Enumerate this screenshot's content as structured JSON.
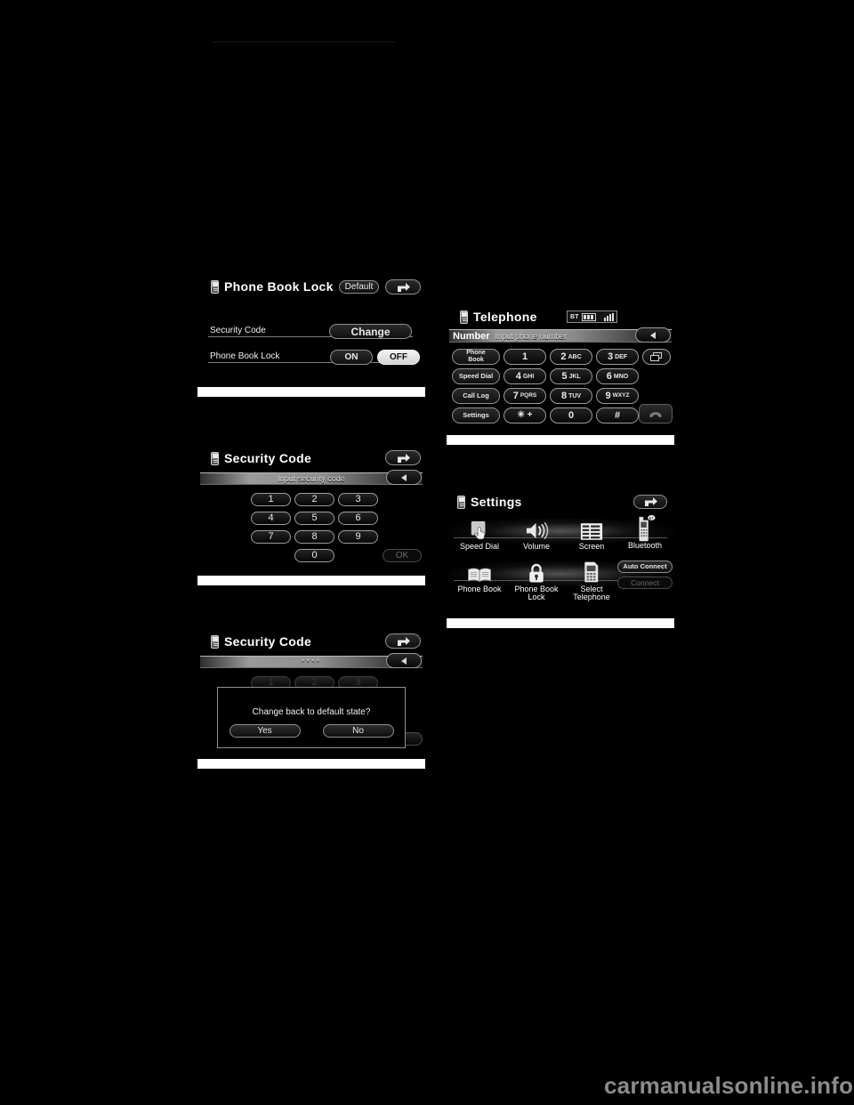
{
  "page": {
    "background": "#000000",
    "watermark": "carmanualsonline.info"
  },
  "screens": {
    "phone_book_lock": {
      "title": "Phone Book Lock",
      "title_icon": "phone-icon",
      "buttons": {
        "default": "Default",
        "back": "back-arrow-icon"
      },
      "rows": [
        {
          "label": "Security Code",
          "action": "Change",
          "action_state": "normal"
        },
        {
          "label": "Phone Book Lock",
          "options": [
            {
              "label": "ON",
              "selected": false
            },
            {
              "label": "OFF",
              "selected": true
            }
          ]
        }
      ]
    },
    "security_code_input": {
      "title": "Security Code",
      "title_icon": "phone-icon",
      "buttons": {
        "back": "back-arrow-icon",
        "delete": "delete-arrow-icon",
        "ok": "OK",
        "ok_state": "disabled"
      },
      "input": {
        "value": "",
        "placeholder": "Input security code"
      },
      "keypad": [
        "1",
        "2",
        "3",
        "4",
        "5",
        "6",
        "7",
        "8",
        "9",
        "0"
      ]
    },
    "security_code_dialog": {
      "title": "Security Code",
      "title_icon": "phone-icon",
      "buttons": {
        "back": "back-arrow-icon",
        "delete": "delete-arrow-icon"
      },
      "input": {
        "value": "****",
        "placeholder": ""
      },
      "keypad_behind": [
        "1",
        "2",
        "3"
      ],
      "dialog": {
        "message": "Change back to default state?",
        "yes": "Yes",
        "no": "No"
      }
    },
    "telephone": {
      "title": "Telephone",
      "title_icon": "phone-icon",
      "status": {
        "bt_label": "BT",
        "battery_bars": 3,
        "signal_bars": 4
      },
      "number_field": {
        "label": "Number",
        "placeholder": "Input phone number",
        "value": ""
      },
      "side_buttons": [
        "Phone\nBook",
        "Speed Dial",
        "Call Log",
        "Settings"
      ],
      "side_buttons_flat": [
        "Phone Book",
        "Speed Dial",
        "Call Log",
        "Settings"
      ],
      "keys": [
        {
          "digit": "1",
          "letters": ""
        },
        {
          "digit": "2",
          "letters": "ABC"
        },
        {
          "digit": "3",
          "letters": "DEF"
        },
        {
          "digit": "4",
          "letters": "GHI"
        },
        {
          "digit": "5",
          "letters": "JKL"
        },
        {
          "digit": "6",
          "letters": "MNO"
        },
        {
          "digit": "7",
          "letters": "PQRS"
        },
        {
          "digit": "8",
          "letters": "TUV"
        },
        {
          "digit": "9",
          "letters": "WXYZ"
        },
        {
          "digit": "✳ +",
          "letters": ""
        },
        {
          "digit": "0",
          "letters": ""
        },
        {
          "digit": "#",
          "letters": ""
        }
      ],
      "right_buttons": [
        {
          "name": "switch-window-icon"
        },
        {
          "name": "call-handset-icon"
        }
      ]
    },
    "settings": {
      "title": "Settings",
      "title_icon": "phone-icon",
      "buttons": {
        "back": "back-arrow-icon"
      },
      "items": [
        {
          "label": "Speed Dial",
          "icon": "hand-touch-icon"
        },
        {
          "label": "Volume",
          "icon": "speaker-icon"
        },
        {
          "label": "Screen",
          "icon": "screen-list-icon"
        },
        {
          "label": "Bluetooth",
          "icon": "bluetooth-phone-icon"
        },
        {
          "label": "Phone Book",
          "icon": "open-book-icon"
        },
        {
          "label": "Phone Book\nLock",
          "icon": "padlock-icon"
        },
        {
          "label": "Select\nTelephone",
          "icon": "select-phone-icon"
        }
      ],
      "bluetooth_buttons": [
        {
          "label": "Auto Connect",
          "state": "enabled"
        },
        {
          "label": "Connect",
          "state": "disabled"
        }
      ]
    }
  }
}
